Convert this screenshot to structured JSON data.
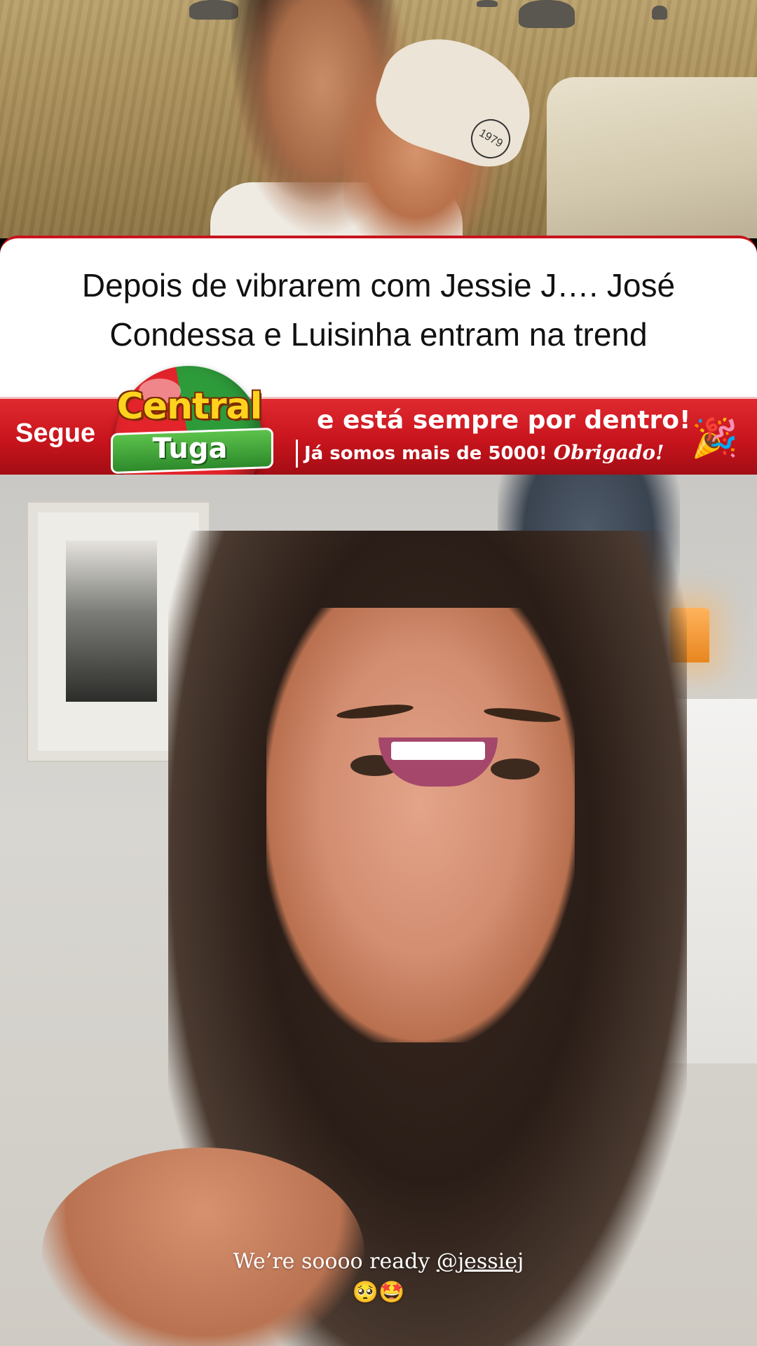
{
  "headline": {
    "text": "Depois de vibrarem com Jessie J…. José Condessa e Luisinha entram na trend"
  },
  "banner": {
    "left_label": "Segue",
    "line1": "e está sempre por dentro!",
    "line2_prefix": "Já somos mais de 5000!",
    "line2_script": "Obrigado!",
    "party_icon": "🎉"
  },
  "logo": {
    "word1": "Central",
    "word2": "Tuga"
  },
  "top_photo": {
    "cap_logo_text": "1979"
  },
  "story_caption": {
    "text": "We’re soooo ready",
    "mention": "@jessiej",
    "emojis": "🥺🤩"
  },
  "colors": {
    "banner_red": "#c8141d",
    "logo_yellow": "#ffd21e",
    "logo_green": "#2e9b3a"
  }
}
